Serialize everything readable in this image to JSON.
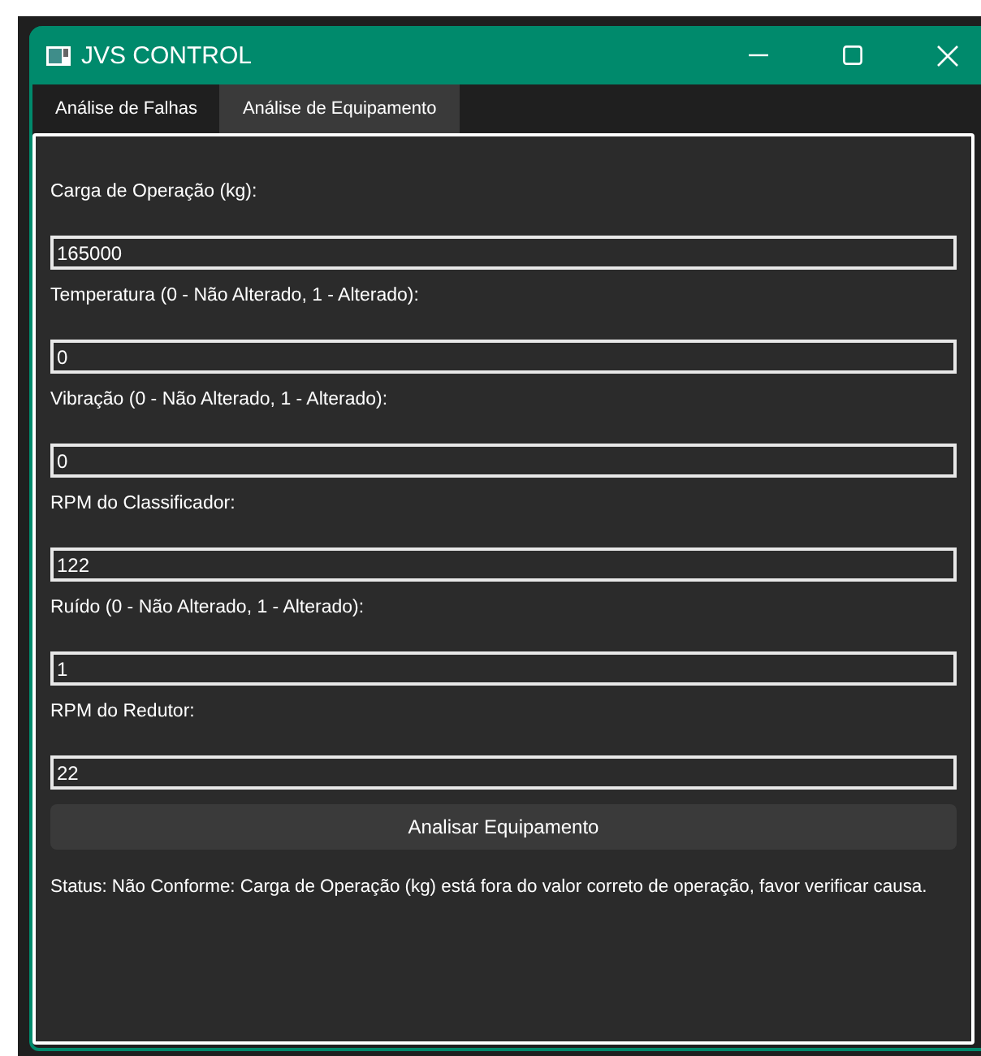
{
  "window": {
    "title": "JVS CONTROL"
  },
  "tabs": [
    {
      "label": "Análise de Falhas",
      "selected": false
    },
    {
      "label": "Análise de Equipamento",
      "selected": true
    }
  ],
  "fields": [
    {
      "label": "Carga de Operação (kg):",
      "value": "165000"
    },
    {
      "label": "Temperatura (0 - Não Alterado, 1 - Alterado):",
      "value": "0"
    },
    {
      "label": "Vibração (0 - Não Alterado, 1 - Alterado):",
      "value": "0"
    },
    {
      "label": "RPM do Classificador:",
      "value": "122"
    },
    {
      "label": "Ruído (0 - Não Alterado, 1 - Alterado):",
      "value": "1"
    },
    {
      "label": "RPM do Redutor:",
      "value": "22"
    }
  ],
  "button": "Analisar Equipamento",
  "status": "Status: Não Conforme: Carga de Operação (kg) está fora do valor correto de operação, favor verificar causa."
}
